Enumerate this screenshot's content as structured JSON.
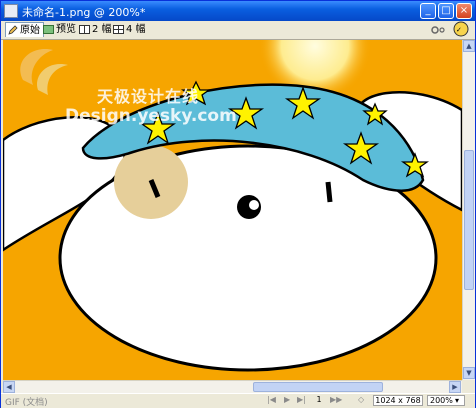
{
  "window": {
    "title": "未命名-1.png @ 200%*",
    "minimize_glyph": "_",
    "maximize_glyph": "□",
    "close_glyph": "×"
  },
  "toolbar": {
    "tabs": [
      {
        "label": "原始",
        "icon": "pencil-icon"
      },
      {
        "label": "预览",
        "icon": "image-preview-icon"
      },
      {
        "label": "2 幅",
        "icon": "two-up-icon"
      },
      {
        "label": "4 幅",
        "icon": "four-up-icon"
      }
    ]
  },
  "watermark": {
    "cn": "天极设计在线",
    "en": "Design.yesky.com"
  },
  "status": {
    "left": "GIF (文档)",
    "page": "1",
    "size": "1024 x 768",
    "zoom": "200%",
    "nav_first": "|◀",
    "nav_play": "▶",
    "nav_next": "▶|",
    "nav_last": "▶▶",
    "loop": "◇"
  },
  "colors": {
    "background": "#f6a500",
    "hat": "#5bbcd8",
    "star": "#fff200",
    "cheek": "#e6cf9a",
    "face": "#ffffff"
  }
}
